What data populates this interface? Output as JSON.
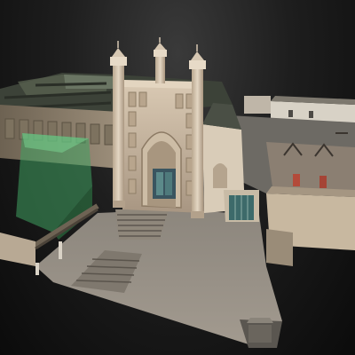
{
  "scene": {
    "subject": "photogrammetry-3d-model",
    "colors": {
      "background_top": "#3a3a3a",
      "background_bottom": "#0b0b0b",
      "facade": "#c9b9a3",
      "courtyard": "#9a9186",
      "selection_overlay": "#5fe08a"
    }
  }
}
